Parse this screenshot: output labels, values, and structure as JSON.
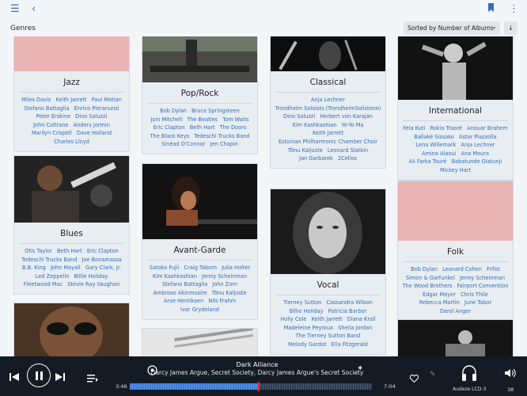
{
  "header": {
    "menu_icon": "hamburger-icon",
    "back_icon": "chevron-left-icon",
    "bookmark_icon": "bookmark-icon",
    "more_icon": "more-vertical-icon"
  },
  "toolbar": {
    "title": "Genres",
    "sort_label": "Sorted by Number of Albums",
    "sort_direction_icon": "arrow-down-icon"
  },
  "genres": [
    {
      "name": "Jazz",
      "image": "pink-placeholder",
      "artists": [
        "Miles Davis",
        "Keith Jarrett",
        "Paul Motian",
        "Stefano Battaglia",
        "Enrico Pieranunzi",
        "Peter Erskine",
        "Dino Saluzzi",
        "John Coltrane",
        "Anders Jormin",
        "Marilyn Crispell",
        "Dave Holland",
        "Charles Lloyd"
      ]
    },
    {
      "name": "Blues",
      "image": "photo",
      "artists": [
        "Otis Taylor",
        "Beth Hart",
        "Eric Clapton",
        "Tedeschi Trucks Band",
        "Joe Bonamassa",
        "B.B. King",
        "John Mayall",
        "Gary Clark, Jr.",
        "Led Zeppelin",
        "Billie Holiday",
        "Fleetwood Mac",
        "Stevie Ray Vaughan"
      ]
    },
    {
      "name": "Pop/Rock",
      "image": "photo",
      "artists": [
        "Bob Dylan",
        "Bruce Springsteen",
        "Joni Mitchell",
        "The Beatles",
        "Tom Waits",
        "Eric Clapton",
        "Beth Hart",
        "The Doors",
        "The Black Keys",
        "Tedeschi Trucks Band",
        "Sinéad O'Connor",
        "Jen Chapin"
      ]
    },
    {
      "name": "Avant-Garde",
      "image": "photo",
      "artists": [
        "Satoko Fujii",
        "Craig Taborn",
        "Julia Holter",
        "Kim Kashkashian",
        "Jenny Scheinman",
        "Stefano Battaglia",
        "John Zorn",
        "Ambrose Akinmusire",
        "Tõnu Kaljuste",
        "Arve Henriksen",
        "Nils Frahm",
        "Ivar Grydeland"
      ]
    },
    {
      "name": "Classical",
      "image": "photo",
      "artists": [
        "Anja Lechner",
        "Trondheim Soloists (TrondheimSolistene)",
        "Dino Saluzzi",
        "Herbert von Karajan",
        "Kim Kashkashian",
        "Yo-Yo Ma",
        "Keith Jarrett",
        "Estonian Philharmonic Chamber Choir",
        "Tõnu Kaljuste",
        "Leonard Slatkin",
        "Jan Garbarek",
        "2Cellos"
      ]
    },
    {
      "name": "Vocal",
      "image": "photo",
      "artists": [
        "Tierney Sutton",
        "Cassandra Wilson",
        "Billie Holiday",
        "Patricia Barber",
        "Holly Cole",
        "Keith Jarrett",
        "Diana Krall",
        "Madeleine Peyroux",
        "Sheila Jordan",
        "The Tierney Sutton Band",
        "Melody Gardot",
        "Ella Fitzgerald"
      ]
    },
    {
      "name": "International",
      "image": "photo",
      "artists": [
        "Fela Kuti",
        "Rokia Traoré",
        "Anouar Brahem",
        "Ballaké Sissoko",
        "Astor Piazzolla",
        "Lena Willemark",
        "Anja Lechner",
        "Amina Alaoui",
        "Ana Moura",
        "Ali Farka Touré",
        "Babatunde Olatunji",
        "Mickey Hart"
      ]
    },
    {
      "name": "Folk",
      "image": "pink-placeholder",
      "artists": [
        "Bob Dylan",
        "Leonard Cohen",
        "Frifot",
        "Simon & Garfunkel",
        "Jenny Scheinman",
        "The Wood Brothers",
        "Fairport Convention",
        "Edgar Meyer",
        "Chris Thile",
        "Rebecca Martin",
        "June Tabor",
        "Darol Anger"
      ]
    }
  ],
  "player": {
    "title": "Dark Alliance",
    "subtitle": "Darcy James Argue, Secret Society, Darcy James Argue's Secret Society",
    "elapsed": "3:46",
    "duration": "7:04",
    "progress": 0.534,
    "device": "Audeze LCD-3",
    "volume": "38",
    "icons": [
      "previous-icon",
      "pause-icon",
      "next-icon",
      "queue-icon",
      "radio-icon",
      "sparkle-icon",
      "heart-icon",
      "unpin-icon",
      "headphones-icon",
      "volume-icon"
    ]
  }
}
